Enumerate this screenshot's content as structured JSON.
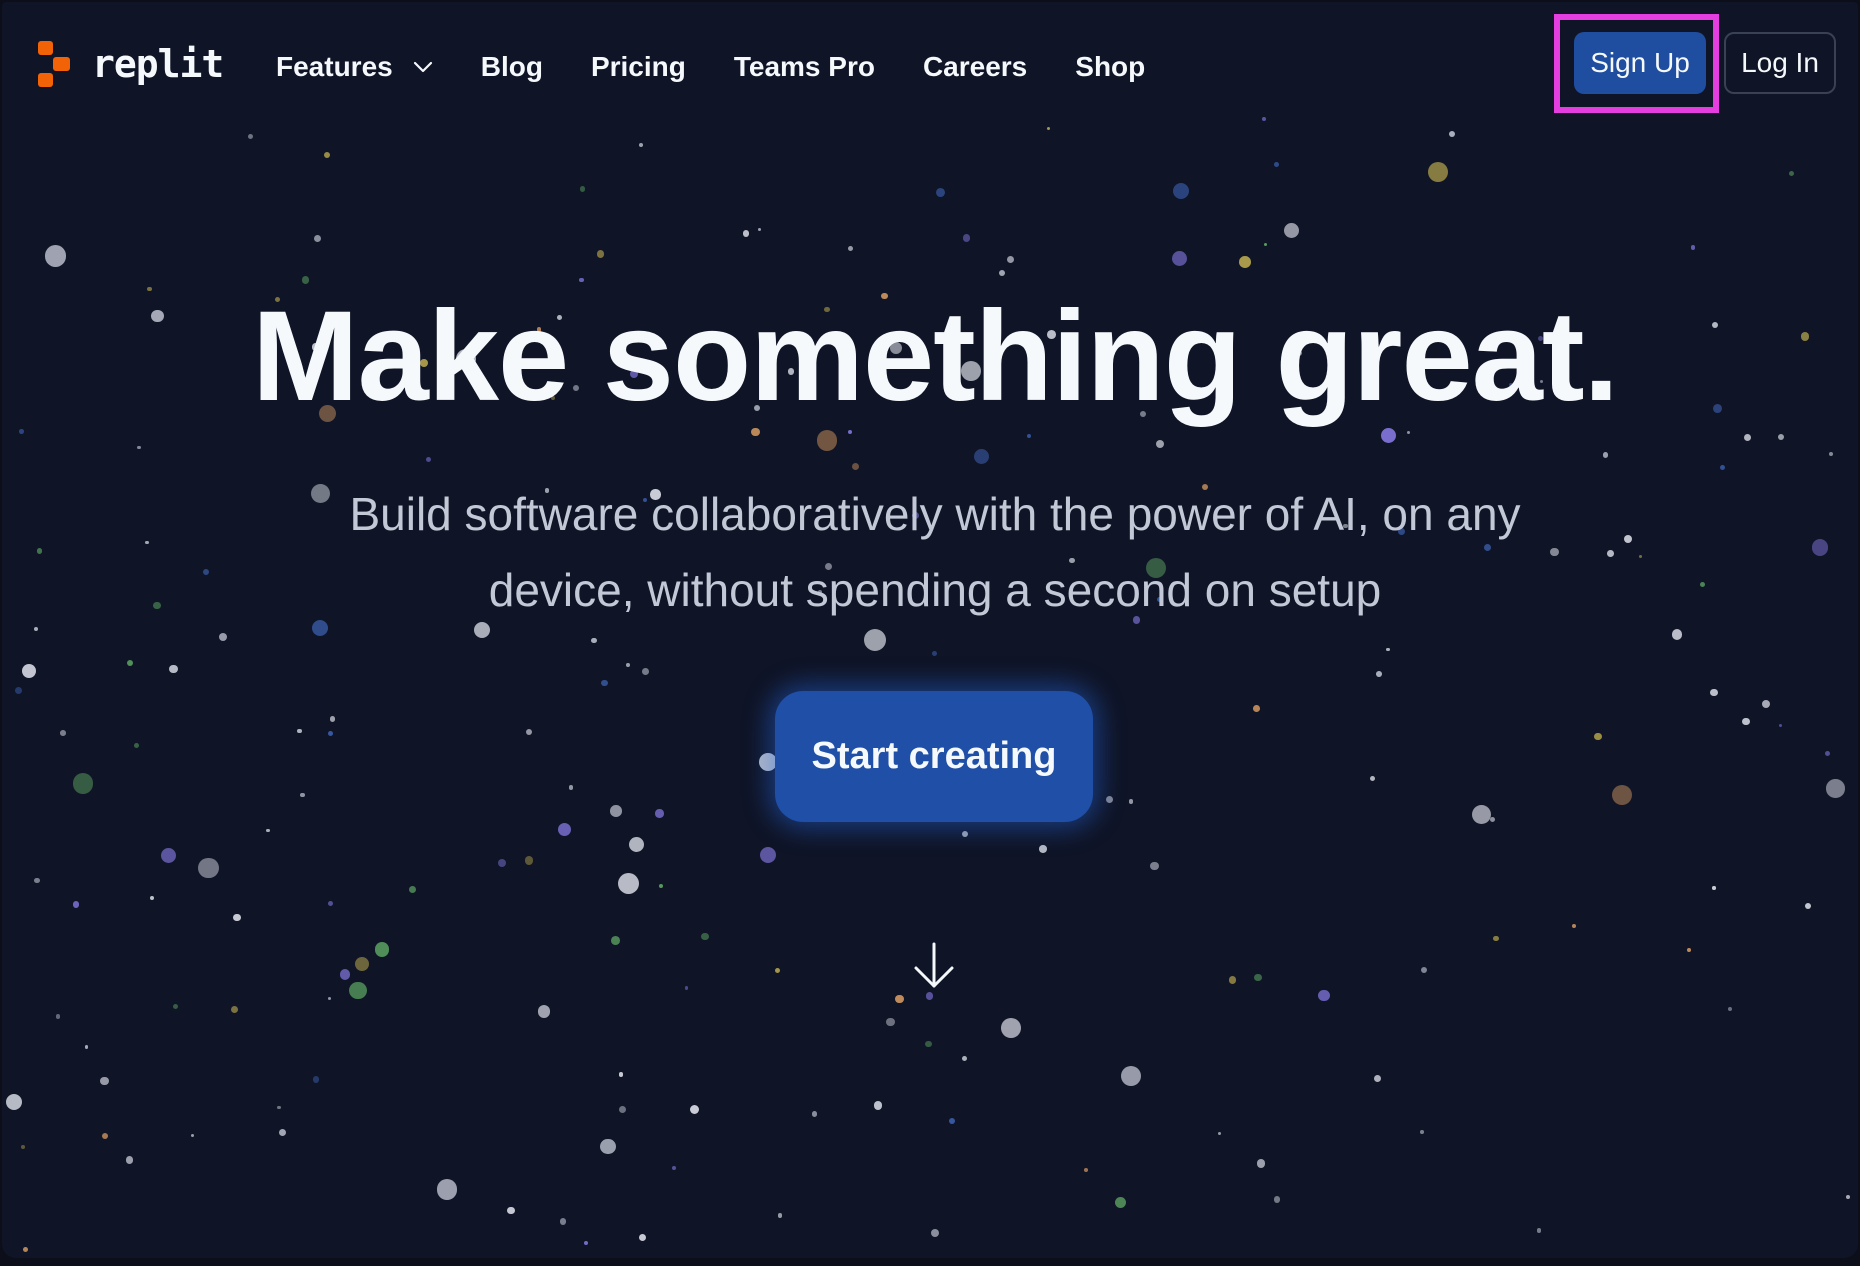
{
  "colors": {
    "background": "#0f1426",
    "text": "#f5f9fc",
    "subtitle": "#c2c8d6",
    "primary_button": "#1f4fa6",
    "brand_orange": "#f26207",
    "highlight": "#e53ee0"
  },
  "nav": {
    "logo_text": "replit",
    "logo_icon": "replit-logo-icon",
    "links": [
      {
        "label": "Features",
        "icon": "chevron-down-icon"
      },
      {
        "label": "Blog"
      },
      {
        "label": "Pricing"
      },
      {
        "label": "Teams Pro"
      },
      {
        "label": "Careers"
      },
      {
        "label": "Shop"
      }
    ],
    "signup_label": "Sign Up",
    "login_label": "Log In"
  },
  "hero": {
    "title": "Make something great.",
    "subtitle": "Build software collaboratively with the power of AI, on any device, without spending a second on setup",
    "cta_label": "Start creating",
    "scroll_icon": "arrow-down-icon"
  }
}
